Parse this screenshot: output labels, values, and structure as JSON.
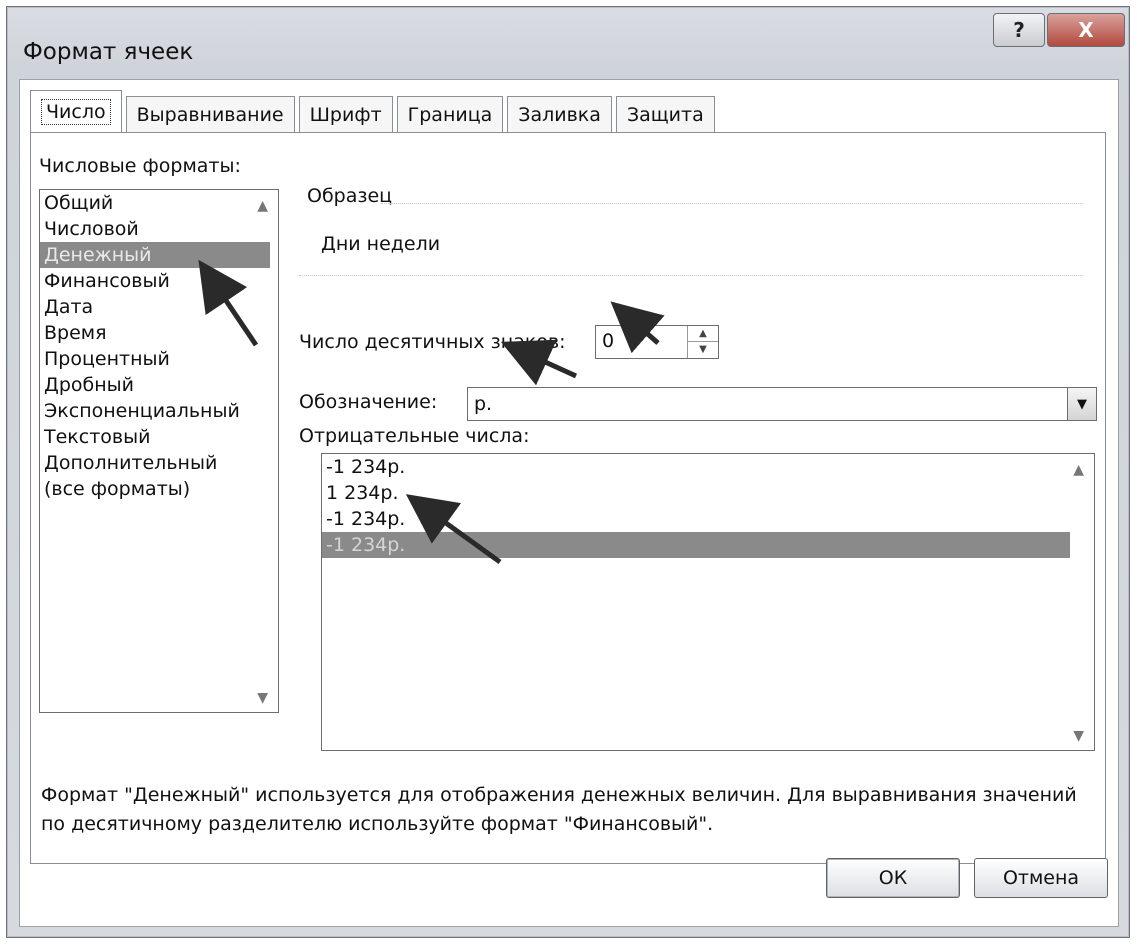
{
  "window": {
    "title": "Формат ячеек",
    "help_label": "?",
    "close_label": "X"
  },
  "tabs": [
    {
      "label": "Число"
    },
    {
      "label": "Выравнивание"
    },
    {
      "label": "Шрифт"
    },
    {
      "label": "Граница"
    },
    {
      "label": "Заливка"
    },
    {
      "label": "Защита"
    }
  ],
  "formats": {
    "label": "Числовые форматы:",
    "items": [
      "Общий",
      "Числовой",
      "Денежный",
      "Финансовый",
      "Дата",
      "Время",
      "Процентный",
      "Дробный",
      "Экспоненциальный",
      "Текстовый",
      "Дополнительный",
      "(все форматы)"
    ],
    "selected": "Денежный"
  },
  "sample": {
    "label": "Образец",
    "value": "Дни недели"
  },
  "decimals": {
    "label": "Число десятичных знаков:",
    "value": "0"
  },
  "symbol": {
    "label": "Обозначение:",
    "value": "р."
  },
  "negative": {
    "label": "Отрицательные числа:",
    "items": [
      "-1 234р.",
      "1 234р.",
      "-1 234р.",
      "-1 234р."
    ],
    "selected_index": 3
  },
  "description": "Формат \"Денежный\" используется для отображения денежных величин. Для выравнивания значений по десятичному разделителю используйте формат \"Финансовый\".",
  "buttons": {
    "ok": "ОК",
    "cancel": "Отмена"
  },
  "colors": {
    "selection": "#8a8a8a",
    "close_button": "#b24a3f"
  }
}
